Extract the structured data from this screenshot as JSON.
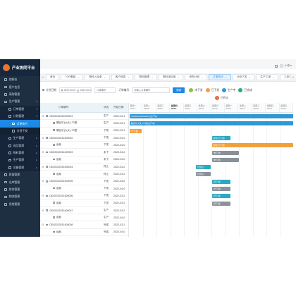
{
  "app": {
    "title": "产业协同平台"
  },
  "sidebar": {
    "items": [
      {
        "label": "控制台",
        "level": 0,
        "state": "normal",
        "arrow": ""
      },
      {
        "label": "客户信息",
        "level": 0,
        "state": "normal",
        "arrow": ""
      },
      {
        "label": "采购管理",
        "level": 0,
        "state": "normal",
        "arrow": ""
      },
      {
        "label": "生产管理",
        "level": 0,
        "state": "normal",
        "arrow": "▾"
      },
      {
        "label": "订单管理",
        "level": 1,
        "state": "normal",
        "arrow": "▾"
      },
      {
        "label": "计划管理",
        "level": 1,
        "state": "normal",
        "arrow": "▾"
      },
      {
        "label": "订单执行",
        "level": 2,
        "state": "active",
        "arrow": ""
      },
      {
        "label": "计划下发",
        "level": 2,
        "state": "normal",
        "arrow": ""
      },
      {
        "label": "生产管理",
        "level": 1,
        "state": "normal",
        "arrow": "▸"
      },
      {
        "label": "成品管理",
        "level": 1,
        "state": "normal",
        "arrow": "▸"
      },
      {
        "label": "物料管理",
        "level": 1,
        "state": "normal",
        "arrow": "▸"
      },
      {
        "label": "生产管理",
        "level": 1,
        "state": "normal",
        "arrow": "▸"
      },
      {
        "label": "设备管理",
        "level": 1,
        "state": "normal",
        "arrow": "▸"
      },
      {
        "label": "质量管理",
        "level": 0,
        "state": "normal",
        "arrow": ""
      },
      {
        "label": "仓库管理",
        "level": 0,
        "state": "normal",
        "arrow": ""
      },
      {
        "label": "财务管理",
        "level": 0,
        "state": "normal",
        "arrow": ""
      },
      {
        "label": "物流管理",
        "level": 0,
        "state": "normal",
        "arrow": ""
      },
      {
        "label": "系统管理",
        "level": 0,
        "state": "normal",
        "arrow": ""
      }
    ]
  },
  "tabs": {
    "prev": "«",
    "next": "»",
    "items": [
      {
        "label": "首页",
        "current": false
      },
      {
        "label": "TOP看板",
        "current": false
      },
      {
        "label": "物料入库单",
        "current": false
      },
      {
        "label": "客户信息",
        "current": false
      },
      {
        "label": "物料管理",
        "current": false
      },
      {
        "label": "物料添加单",
        "current": false
      },
      {
        "label": "采购计划",
        "current": false
      },
      {
        "label": "订单执行",
        "current": true
      },
      {
        "label": "计划下发",
        "current": false
      },
      {
        "label": "生产工单",
        "current": false
      },
      {
        "label": "工序报工",
        "current": false
      }
    ]
  },
  "user": {
    "name": "小卷 ▾"
  },
  "toolbar": {
    "date_filter_label": "计划日期",
    "date_start": "2022-03-01",
    "date_sep": "至",
    "date_end": "2022-03-31",
    "order_placeholder": "订单编号",
    "order_no_label": "订单编号",
    "order_no_placeholder": "请输入订单编号",
    "search_label": "搜索",
    "legend": [
      {
        "label": "未下发",
        "color": "#8bc34a"
      },
      {
        "label": "已下发",
        "color": "#f0a13c"
      },
      {
        "label": "生产中",
        "color": "#2f97d4"
      },
      {
        "label": "已完成",
        "color": "#2aa882"
      }
    ],
    "legend_extra": {
      "label": "已终止",
      "color": "#e86a4d"
    }
  },
  "table": {
    "headers": [
      "订单编号",
      "状态",
      "开始日期"
    ],
    "rows": [
      {
        "code": "OD02022031000001",
        "status": "生产",
        "date": "2022-03-1",
        "child": false
      },
      {
        "code": "螺丝钉(大头)-T3型",
        "status": "生产",
        "date": "2022-03-1",
        "child": true
      },
      {
        "code": "螺丝钉(大头)-T3型",
        "status": "下发",
        "date": "2022-03-1",
        "child": true
      },
      {
        "code": "OD02022031400002",
        "status": "下发",
        "date": "2022-04-0",
        "child": false
      },
      {
        "code": "齿轮",
        "status": "下发",
        "date": "2022-04-0",
        "child": true
      },
      {
        "code": "OD02022031400003",
        "status": "未下",
        "date": "2022-03-2",
        "child": false
      },
      {
        "code": "齿轮",
        "status": "未下",
        "date": "2022-04-0",
        "child": true
      },
      {
        "code": "OD02022031400004",
        "status": "终止",
        "date": "2022-03-2",
        "child": false
      },
      {
        "code": "齿轮",
        "status": "终止",
        "date": "2022-03-2",
        "child": true
      },
      {
        "code": "OD02022031400005",
        "status": "下发",
        "date": "2022-04-0",
        "child": false
      },
      {
        "code": "齿轮",
        "status": "下发",
        "date": "2022-04-0",
        "child": true
      },
      {
        "code": "OD02022031400006",
        "status": "下发",
        "date": "2022-03-2",
        "child": false
      },
      {
        "code": "齿轮",
        "status": "下发",
        "date": "2022-03-2",
        "child": true
      },
      {
        "code": "OD02022031400007",
        "status": "生产",
        "date": "2022-03-2",
        "child": false
      },
      {
        "code": "齿轮",
        "status": "生产",
        "date": "2022-04-0",
        "child": true
      },
      {
        "code": "OD02022031400008",
        "status": "完成",
        "date": "2022-03-1",
        "child": false
      },
      {
        "code": "齿轮",
        "status": "完成",
        "date": "2022-04-0",
        "child": true
      }
    ]
  },
  "gantt": {
    "columns": [
      {
        "week": "星期一",
        "date": "03/07"
      },
      {
        "week": "星期二",
        "date": "03/08"
      },
      {
        "week": "星期三",
        "date": "03/09"
      },
      {
        "week": "星期四",
        "date": "03/10"
      },
      {
        "week": "星期五",
        "date": "03/11"
      },
      {
        "week": "星期六",
        "date": "03/12"
      },
      {
        "week": "星期日",
        "date": "03/13"
      },
      {
        "week": "星期一",
        "date": "03/14"
      },
      {
        "week": "星期二",
        "date": "03/15"
      },
      {
        "week": "星期三",
        "date": "03/16"
      },
      {
        "week": "星期四",
        "date": "03/17"
      },
      {
        "week": "星期五",
        "date": "03/18"
      }
    ],
    "today_index": 3,
    "bars": [
      {
        "label": "OD02022031000001(生产中)",
        "color": "#2f97d4",
        "row": 0,
        "start": 0.0,
        "end": 1.0
      },
      {
        "label": "螺丝钉(大头)-T3型(生产中)",
        "color": "#2f97d4",
        "row": 1,
        "start": 0.0,
        "end": 1.0
      },
      {
        "label": "(已下发)",
        "color": "#f0a13c",
        "row": 2,
        "start": 0.0,
        "end": 0.08
      },
      {
        "label": "齿轮(已下发)",
        "color": "#2aa9c2",
        "row": 3,
        "start": 0.5,
        "end": 0.62
      },
      {
        "label": "齿轮(已下发)",
        "color": "#f0a13c",
        "row": 4,
        "start": 0.5,
        "end": 1.0
      },
      {
        "label": "(未下发)",
        "color": "#8a9199",
        "row": 5,
        "start": 0.5,
        "end": 0.67
      },
      {
        "label": "(未下发)",
        "color": "#8a9199",
        "row": 6,
        "start": 0.5,
        "end": 0.67
      },
      {
        "label": "(已终止)",
        "color": "#2aa9c2",
        "row": 7,
        "start": 0.4,
        "end": 0.5
      },
      {
        "label": "(已终止)",
        "color": "#8a9199",
        "row": 8,
        "start": 0.4,
        "end": 0.5
      },
      {
        "label": "(已下发)",
        "color": "#2aa9c2",
        "row": 9,
        "start": 0.5,
        "end": 0.62
      },
      {
        "label": "(已下发)",
        "color": "#8a9199",
        "row": 10,
        "start": 0.5,
        "end": 0.62
      },
      {
        "label": "(已下发)",
        "color": "#2aa9c2",
        "row": 11,
        "start": 0.5,
        "end": 0.62
      },
      {
        "label": "(已下发)",
        "color": "#8a9199",
        "row": 12,
        "start": 0.5,
        "end": 0.62
      }
    ]
  }
}
